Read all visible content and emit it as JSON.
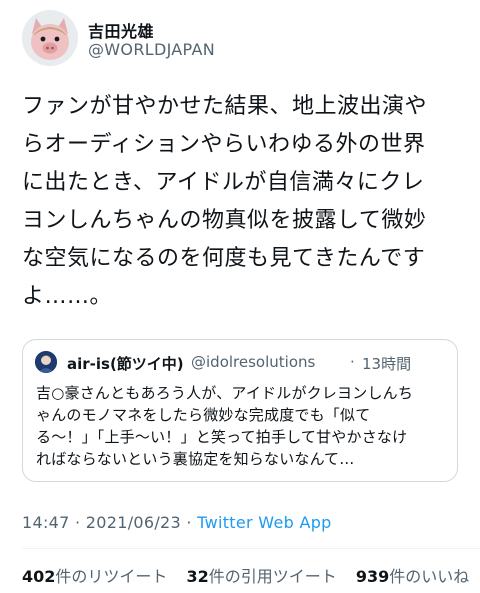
{
  "author": {
    "display_name": "吉田光雄",
    "handle": "@WORLDJAPAN"
  },
  "tweet": {
    "text": "ファンが甘やかせた結果、地上波出演や\nらオーディションやらいわゆる外の世界\nに出たとき、アイドルが自信満々にクレ\nヨンしんちゃんの物真似を披露して微妙\nな空気になるのを何度も見てきたんです\nよ……。"
  },
  "quoted_tweet": {
    "display_name": "air-is(節ツイ中)",
    "handle": "@idolresolutions",
    "separator": "·",
    "time": "13時間",
    "text": "吉○豪さんともあろう人が、アイドルがクレヨンしんち\nゃんのモノマネをしたら微妙な完成度でも「似て\nる〜！」「上手〜い！」と笑って拍手して甘やかさなけ\nればならないという裏協定を知らないなんて…"
  },
  "meta": {
    "time": "14:47",
    "separator": " · ",
    "date": "2021/06/23",
    "source": "Twitter Web App"
  },
  "stats": {
    "retweets": {
      "count": "402",
      "label": "件のリツイート"
    },
    "quotes": {
      "count": "32",
      "label": "件の引用ツイート"
    },
    "likes": {
      "count": "939",
      "label": "件のいいね"
    }
  },
  "colors": {
    "link": "#1d9bf0",
    "secondary_text": "#536471",
    "border": "#cfd9de"
  }
}
